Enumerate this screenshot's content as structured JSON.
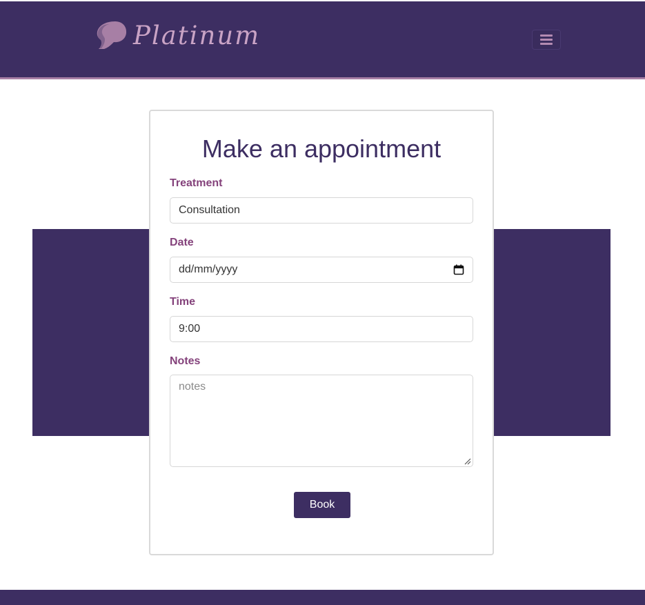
{
  "header": {
    "logo_text": "Platinum",
    "menu_icon": "bars-icon"
  },
  "form": {
    "title": "Make an appointment",
    "treatment": {
      "label": "Treatment",
      "value": "Consultation"
    },
    "date": {
      "label": "Date",
      "value": "dd/mm/yyyy",
      "icon": "calendar-icon"
    },
    "time": {
      "label": "Time",
      "value": "9:00"
    },
    "notes": {
      "label": "Notes",
      "placeholder": "notes"
    },
    "book_label": "Book"
  },
  "colors": {
    "brand_purple": "#3d2e62",
    "label_plum": "#84427b",
    "logo_pink": "#c9a3c5"
  }
}
